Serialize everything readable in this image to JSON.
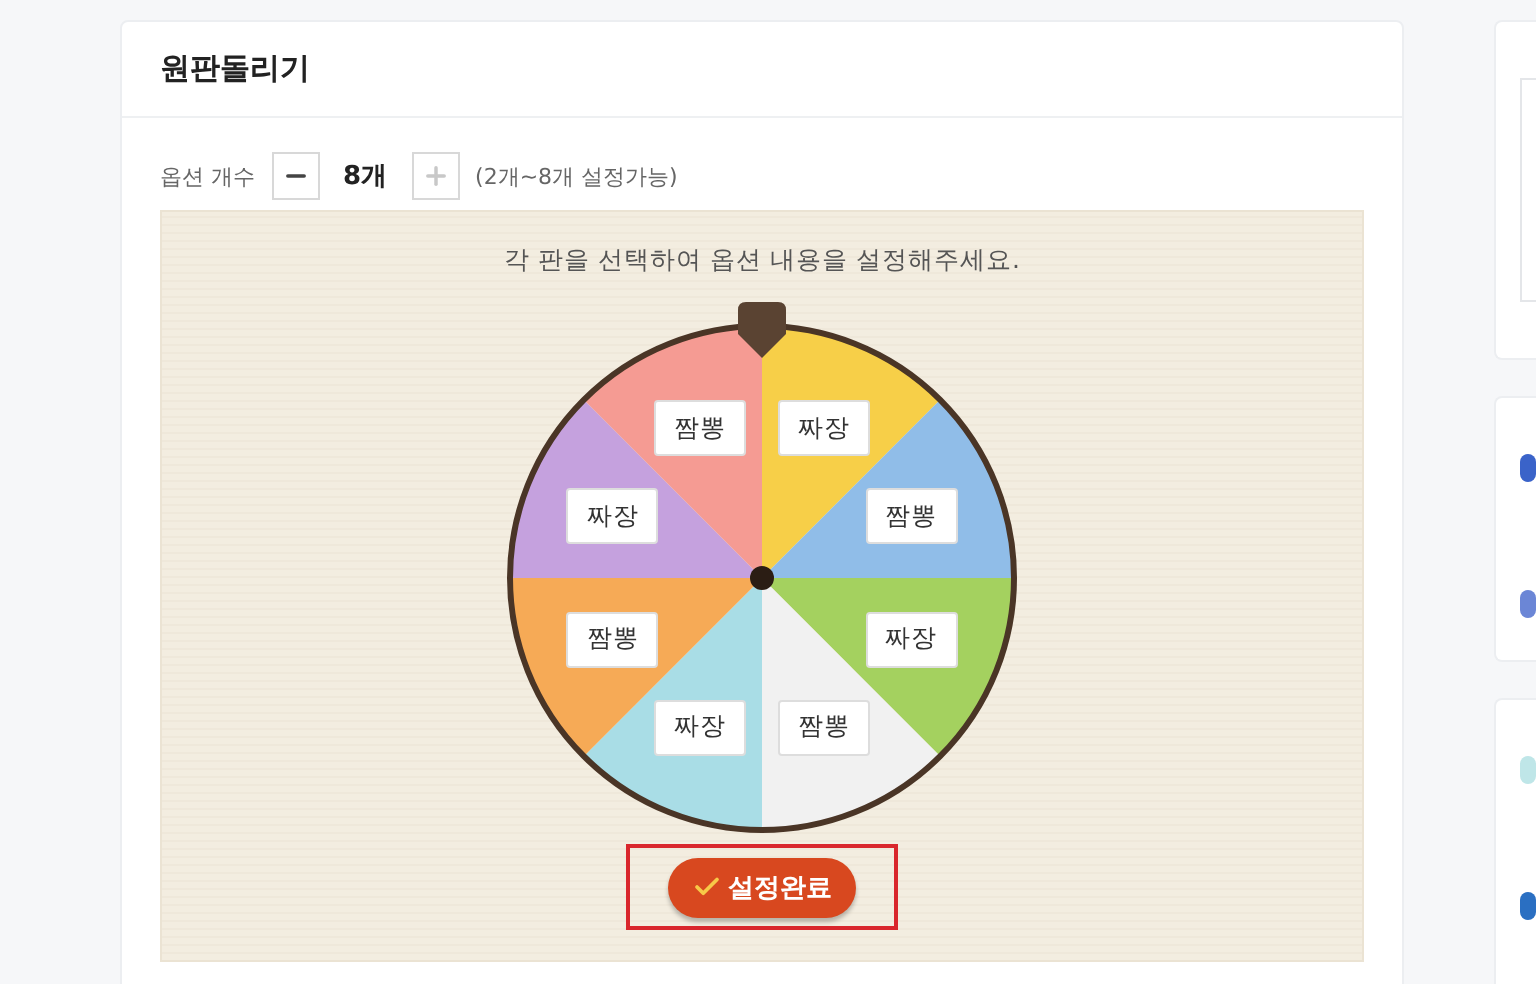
{
  "panel": {
    "title": "원판돌리기"
  },
  "options": {
    "label": "옵션 개수",
    "decrement": {
      "disabled": false
    },
    "count": "8개",
    "increment": {
      "disabled": true
    },
    "hint": "(2개~8개 설정가능)"
  },
  "wheel": {
    "instruction": "각 판을 선택하여 옵션 내용을 설정해주세요.",
    "slices": [
      {
        "label": "짜장",
        "color": "#f7cf48"
      },
      {
        "label": "짬뽕",
        "color": "#90bde8"
      },
      {
        "label": "짜장",
        "color": "#a4d15f"
      },
      {
        "label": "짬뽕",
        "color": "#f1f1f1"
      },
      {
        "label": "짜장",
        "color": "#a9dde6"
      },
      {
        "label": "짬뽕",
        "color": "#f6aa56"
      },
      {
        "label": "짜장",
        "color": "#c5a1de"
      },
      {
        "label": "짬뽕",
        "color": "#f59b93"
      }
    ]
  },
  "confirm_button": {
    "label": "설정완료",
    "highlighted": true
  }
}
